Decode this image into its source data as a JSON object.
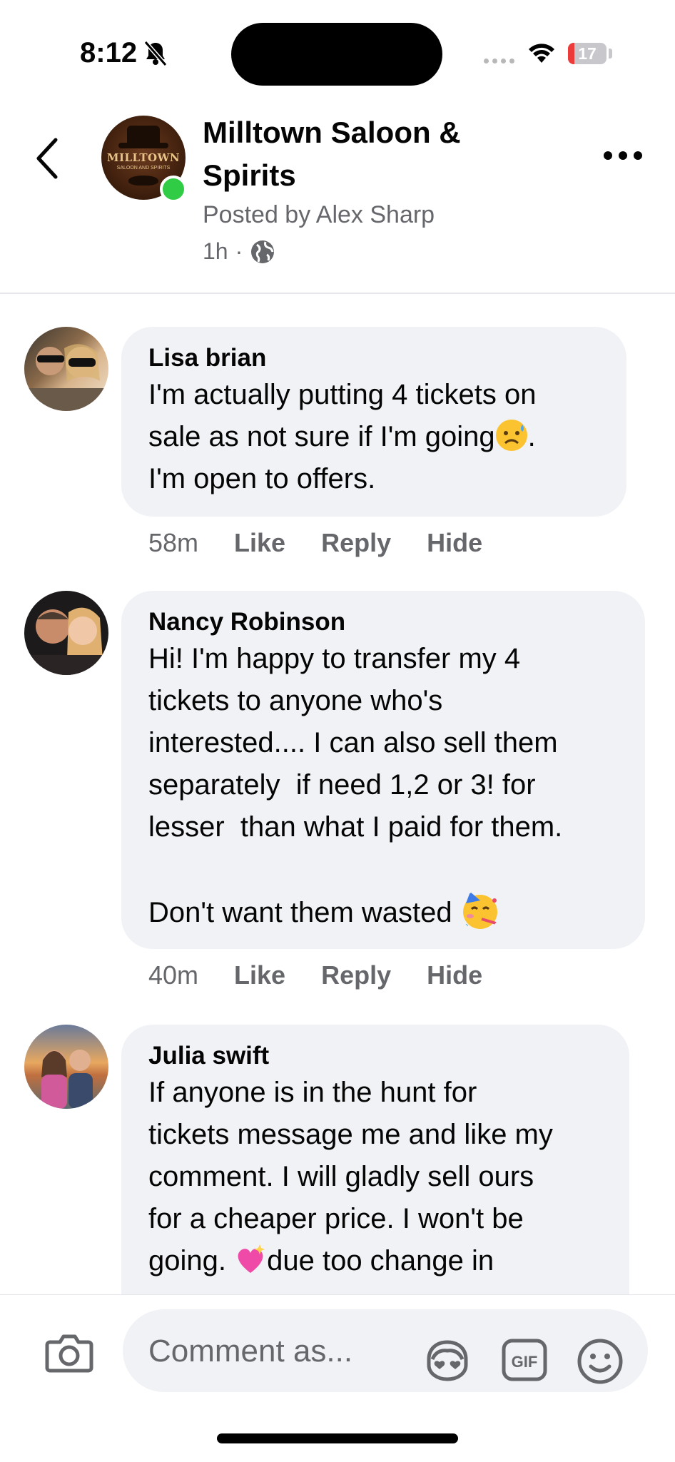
{
  "status_bar": {
    "time": "8:12",
    "battery": "17",
    "battery_level": 0.17
  },
  "header": {
    "page_name": "Milltown Saloon & Spirits",
    "posted_by": "Posted by Alex Sharp",
    "time_ago": "1h",
    "dot": "·",
    "avatar_text": "MILLTOWN",
    "avatar_subtext": "SALOON AND SPIRITS"
  },
  "comments": [
    {
      "author": "Lisa brian",
      "text_lines": [
        "I'm actually putting 4 tickets on",
        "sale as not sure if I'm going",
        ".",
        "I'm open to offers."
      ],
      "time": "58m",
      "like": "Like",
      "reply": "Reply",
      "hide": "Hide"
    },
    {
      "author": "Nancy Robinson",
      "text": "Hi! I'm happy to transfer my 4\ntickets to anyone who's\ninterested.... I can also sell them\nseparately  if need 1,2 or 3! for\nlesser  than what I paid for them.\n\n",
      "text_end": "Don't want them wasted",
      "time": "40m",
      "like": "Like",
      "reply": "Reply",
      "hide": "Hide"
    },
    {
      "author": "Julia swift",
      "text": "If anyone is in the hunt for\ntickets message me and like my\ncomment. I will gladly sell ours\nfor a cheaper price. I won't be\n",
      "text_a": "going. ",
      "text_b": "due too change in"
    }
  ],
  "composer": {
    "placeholder": "Comment as..."
  },
  "icons": [
    "bell-slash-icon",
    "wifi-icon",
    "back-chevron-icon",
    "globe-icon",
    "more-icon",
    "camera-icon",
    "avatar-sticker-icon",
    "gif-icon",
    "emoji-icon"
  ],
  "colors": {
    "online": "#31cc46",
    "bubble": "#f0f2f5",
    "muted": "#65676b",
    "battery_low": "#eb3b3b"
  }
}
